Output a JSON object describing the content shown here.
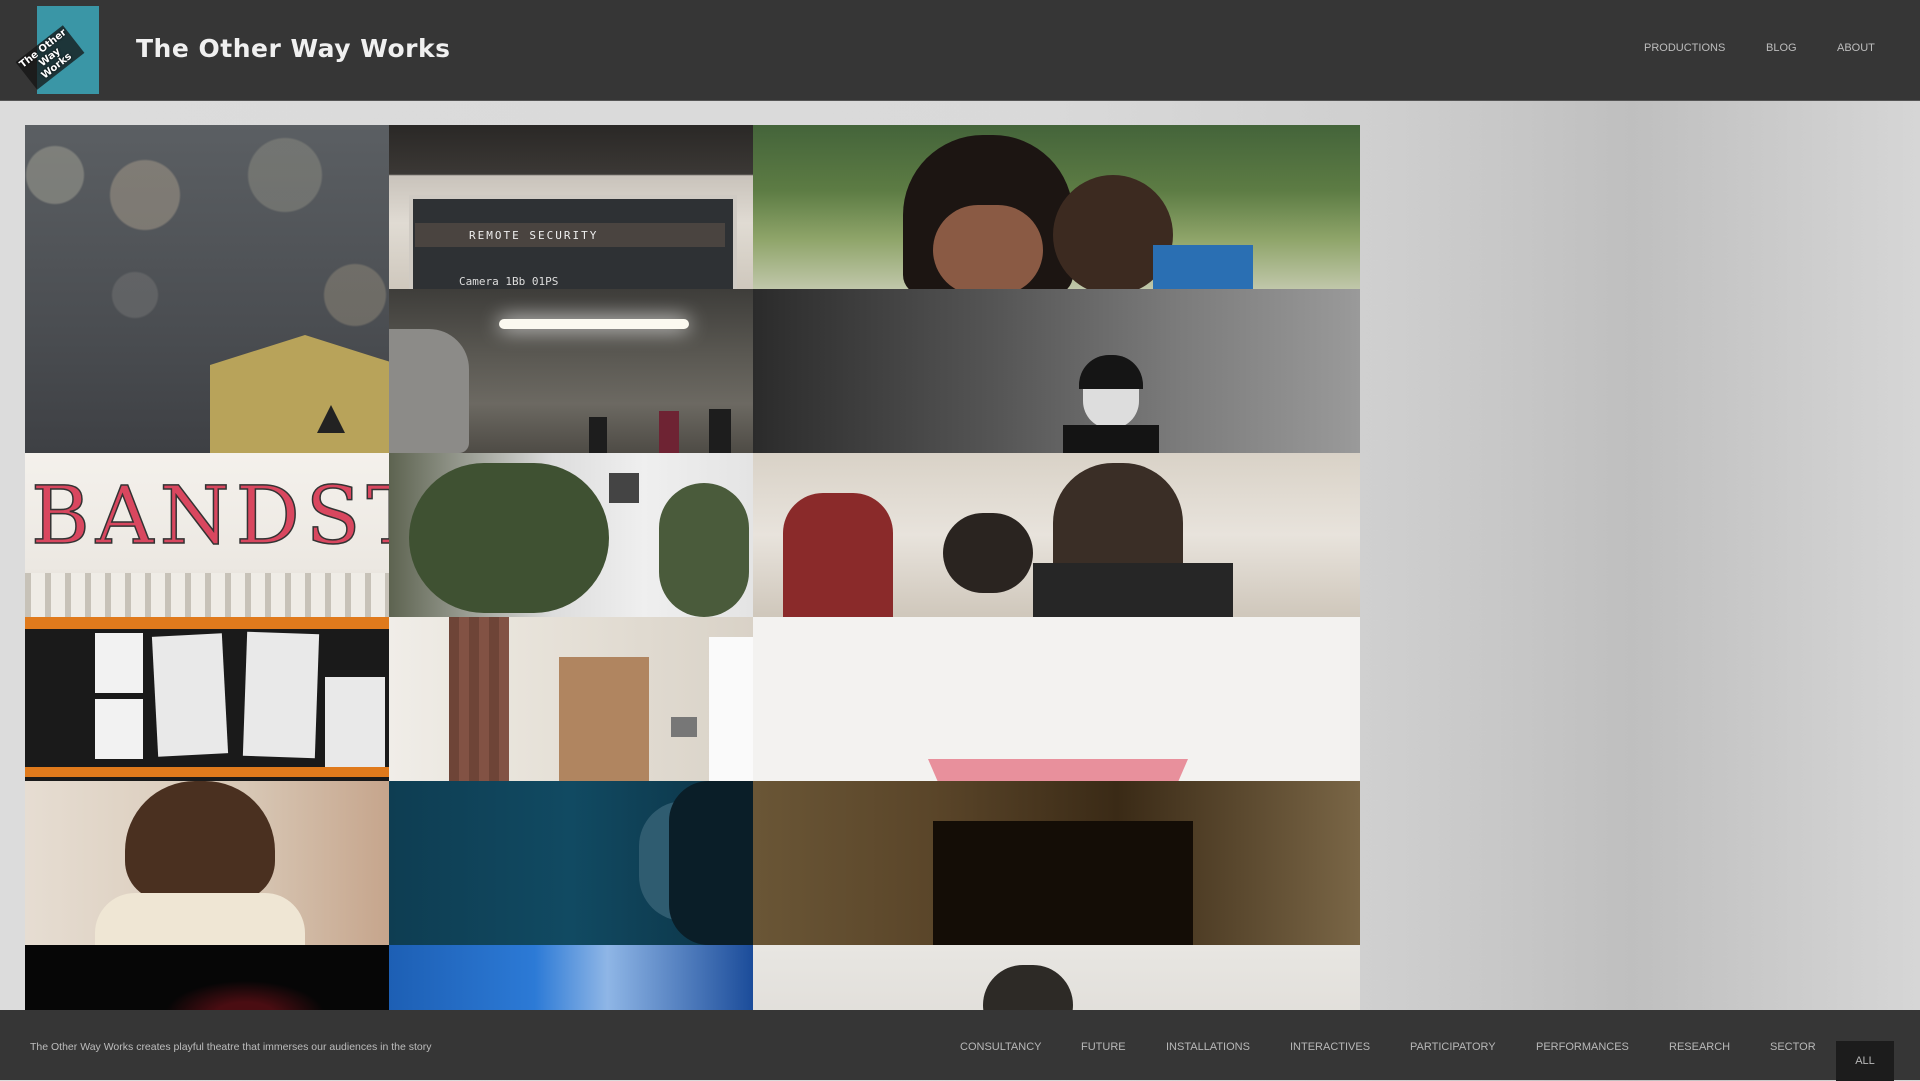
{
  "header": {
    "logo_text": "The Other Way Works",
    "site_title": "The Other Way Works",
    "nav": [
      "PRODUCTIONS",
      "BLOG",
      "ABOUT"
    ]
  },
  "grid": {
    "tiles": [
      {
        "name": "tile-bokeh-lights"
      },
      {
        "name": "tile-remote-security-laptop",
        "text": "REMOTE SECURITY",
        "subtext": "Camera 1Bb 01PS"
      },
      {
        "name": "tile-two-girls-park"
      },
      {
        "name": "tile-car-park-people"
      },
      {
        "name": "tile-woman-in-corridor"
      },
      {
        "name": "tile-bandstand-poster",
        "text": "BANDST"
      },
      {
        "name": "tile-tree-in-courtyard"
      },
      {
        "name": "tile-workshop-group"
      },
      {
        "name": "tile-poster-wall"
      },
      {
        "name": "tile-bedroom-dresser"
      },
      {
        "name": "tile-pink-envelope"
      },
      {
        "name": "tile-woman-from-behind"
      },
      {
        "name": "tile-woman-blue-light"
      },
      {
        "name": "tile-dark-doorway"
      },
      {
        "name": "tile-dark-red"
      },
      {
        "name": "tile-blue-stage"
      },
      {
        "name": "tile-man-tent"
      }
    ]
  },
  "footer": {
    "tagline": "The Other Way Works creates playful theatre that immerses our audiences in the story",
    "filters": [
      "CONSULTANCY",
      "FUTURE",
      "INSTALLATIONS",
      "INTERACTIVES",
      "PARTICIPATORY",
      "PERFORMANCES",
      "RESEARCH",
      "SECTOR"
    ],
    "filter_active": "ALL"
  },
  "colors": {
    "header_bg": "#363636",
    "logo_teal": "#3a96a6",
    "nav_text": "#bdbdbd",
    "active_filter_bg": "#1c1c1c"
  }
}
